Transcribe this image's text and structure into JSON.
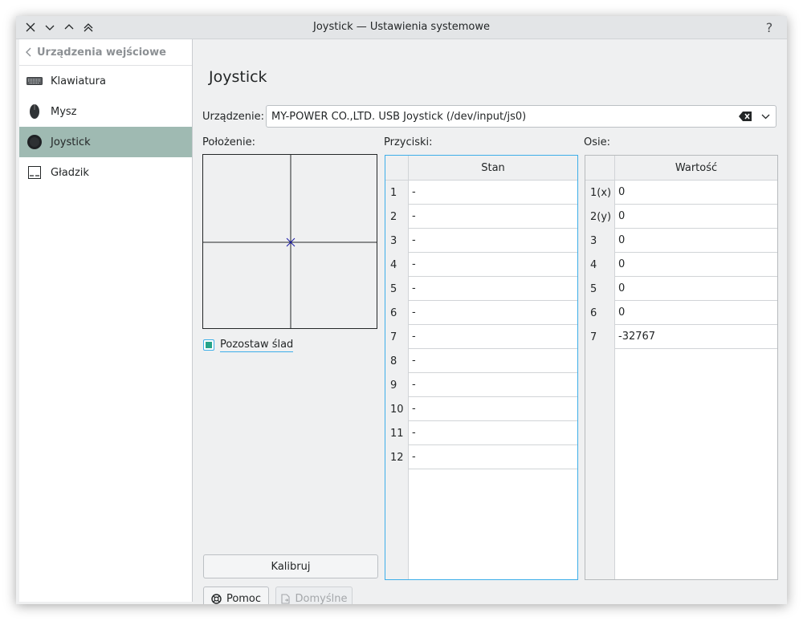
{
  "window": {
    "title": "Joystick — Ustawienia systemowe",
    "help_glyph": "?"
  },
  "sidebar": {
    "back_label": "Urządzenia wejściowe",
    "items": [
      {
        "label": "Klawiatura",
        "icon": "keyboard-icon"
      },
      {
        "label": "Mysz",
        "icon": "mouse-icon"
      },
      {
        "label": "Joystick",
        "icon": "joystick-icon",
        "active": true
      },
      {
        "label": "Gładzik",
        "icon": "touchpad-icon"
      }
    ]
  },
  "page": {
    "title": "Joystick",
    "device_label": "Urządzenie:",
    "device_value": "MY-POWER CO.,LTD. USB Joystick (/dev/input/js0)",
    "position_label": "Położenie:",
    "buttons_label": "Przyciski:",
    "axes_label": "Osie:",
    "trail_label": "Pozostaw ślad",
    "trail_checked": true
  },
  "buttons_table": {
    "header": "Stan",
    "rows": [
      {
        "n": "1",
        "v": "-"
      },
      {
        "n": "2",
        "v": "-"
      },
      {
        "n": "3",
        "v": "-"
      },
      {
        "n": "4",
        "v": "-"
      },
      {
        "n": "5",
        "v": "-"
      },
      {
        "n": "6",
        "v": "-"
      },
      {
        "n": "7",
        "v": "-"
      },
      {
        "n": "8",
        "v": "-"
      },
      {
        "n": "9",
        "v": "-"
      },
      {
        "n": "10",
        "v": "-"
      },
      {
        "n": "11",
        "v": "-"
      },
      {
        "n": "12",
        "v": "-"
      }
    ]
  },
  "axes_table": {
    "header": "Wartość",
    "rows": [
      {
        "n": "1(x)",
        "v": "0"
      },
      {
        "n": "2(y)",
        "v": "0"
      },
      {
        "n": "3",
        "v": "0"
      },
      {
        "n": "4",
        "v": "0"
      },
      {
        "n": "5",
        "v": "0"
      },
      {
        "n": "6",
        "v": "0"
      },
      {
        "n": "7",
        "v": "-32767"
      }
    ]
  },
  "actions": {
    "calibrate": "Kalibruj",
    "help": "Pomoc",
    "defaults": "Domyślne"
  },
  "colors": {
    "active_item": "#9fbab2",
    "focus": "#3daee9",
    "crosshair_marker": "#1a1aa8"
  }
}
